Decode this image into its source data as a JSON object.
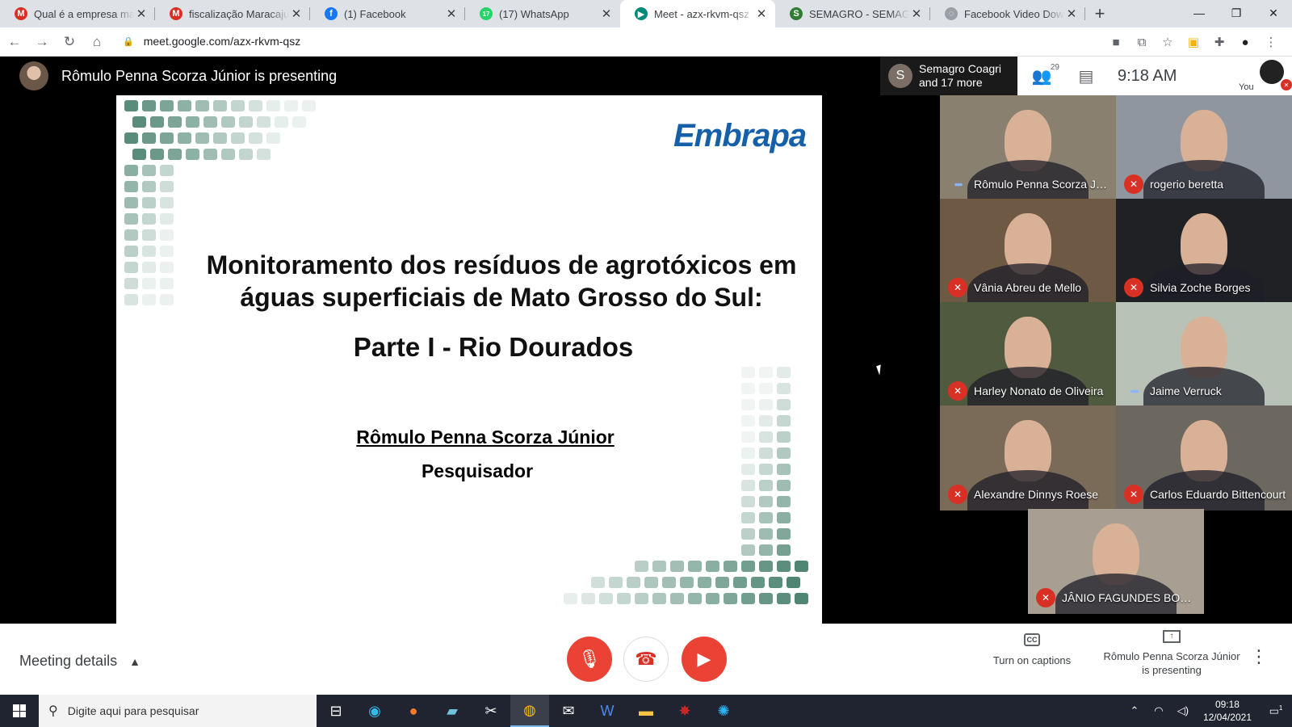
{
  "browser": {
    "tabs": [
      {
        "title": "Qual é a empresa mais p",
        "icon": "gmail-icon",
        "color": "#d93025",
        "glyph": "M"
      },
      {
        "title": "fiscalização Maracaju - se",
        "icon": "gmail-icon",
        "color": "#d93025",
        "glyph": "M"
      },
      {
        "title": "(1) Facebook",
        "icon": "facebook-icon",
        "color": "#1877f2",
        "glyph": "f"
      },
      {
        "title": "(17) WhatsApp",
        "icon": "whatsapp-icon",
        "color": "#25d366",
        "glyph": "17"
      },
      {
        "title": "Meet - azx-rkvm-qsz",
        "icon": "meet-icon",
        "color": "#00897b",
        "glyph": "▶",
        "active": true
      },
      {
        "title": "SEMAGRO - SEMAGRO",
        "icon": "semagro-icon",
        "color": "#2e7d32",
        "glyph": "S"
      },
      {
        "title": "Facebook Video Downlo",
        "icon": "loading-icon",
        "color": "#9aa0a6",
        "glyph": "◌"
      }
    ],
    "url": "meet.google.com/azx-rkvm-qsz"
  },
  "meet": {
    "presenter_label": "Rômulo Penna Scorza Júnior is presenting",
    "others": {
      "initial": "S",
      "line1": "Semagro Coagri",
      "line2": "and 17 more"
    },
    "participants_count": "29",
    "time": "9:18 AM",
    "you_label": "You",
    "slide": {
      "logo": "Embrapa",
      "title_line1": "Monitoramento dos resíduos de agrotóxicos em",
      "title_line2": "águas superficiais de Mato Grosso do Sul:",
      "subtitle": "Parte I - Rio Dourados",
      "author": "Rômulo Penna Scorza Júnior",
      "role": "Pesquisador"
    },
    "tiles": [
      {
        "name": "Rômulo Penna Scorza Jú...",
        "status": "speaking",
        "bg": "#8a8070"
      },
      {
        "name": "rogerio beretta",
        "status": "muted",
        "bg": "#8f96a0"
      },
      {
        "name": "Vânia Abreu de Mello",
        "status": "muted",
        "bg": "#6e5a44"
      },
      {
        "name": "Silvia Zoche Borges",
        "status": "muted",
        "bg": "#202124"
      },
      {
        "name": "Harley Nonato de Oliveira",
        "status": "muted",
        "bg": "#4f5a3e"
      },
      {
        "name": "Jaime Verruck",
        "status": "speaking",
        "bg": "#b8c2b6"
      },
      {
        "name": "Alexandre Dinnys Roese",
        "status": "muted",
        "bg": "#7a6a58"
      },
      {
        "name": "Carlos Eduardo Bittencourt",
        "status": "muted",
        "bg": "#6c6860"
      },
      {
        "name": "JÂNIO FAGUNDES BORG...",
        "status": "muted",
        "bg": "#a89e92"
      }
    ]
  },
  "controls": {
    "meeting_details": "Meeting details",
    "captions_icon": "CC",
    "captions": "Turn on captions",
    "presenting_line1": "Rômulo Penna Scorza Júnior",
    "presenting_line2": "is presenting"
  },
  "taskbar": {
    "search_placeholder": "Digite aqui para pesquisar",
    "time": "09:18",
    "date": "12/04/2021",
    "notifications": "1"
  }
}
